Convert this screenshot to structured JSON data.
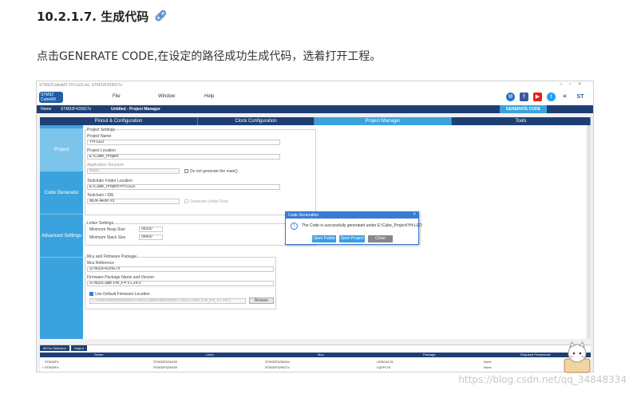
{
  "heading": {
    "title": "10.2.1.7. 生成代码"
  },
  "intro": {
    "text": "点击GENERATE CODE,在设定的路径成功生成代码，选着打开工程。"
  },
  "app": {
    "window_title": "STM32CubeMX YH-LED.ioc: STM32F429IGTx",
    "logo": "STM32 CubeMX",
    "menu": [
      "File",
      "Window",
      "Help"
    ],
    "breadcrumbs": [
      "Home",
      "STM32F429IGTx",
      "Untitled - Project Manager"
    ],
    "generate_label": "GENERATE CODE",
    "tabs": [
      "Pinout & Configuration",
      "Clock Configuration",
      "Project Manager",
      "Tools"
    ],
    "side": [
      "Project",
      "Code Generator",
      "Advanced Settings"
    ],
    "project": {
      "settings_title": "Project Settings",
      "name_label": "Project Name",
      "name_value": "YH-LED",
      "location_label": "Project Location",
      "location_value": "E:\\Cube_Project",
      "structure_label": "Application Structure",
      "structure_value": "Basic",
      "no_main_label": "Do not generate the main()",
      "toolchain_folder_label": "Toolchain Folder Location",
      "toolchain_folder_value": "E:\\Cube_Project\\YH-LED\\",
      "ide_label": "Toolchain / IDE",
      "ide_value": "MDK-ARM V5",
      "gen_under_root": "Generate Under Root",
      "linker_title": "Linker Settings",
      "heap_label": "Minimum Heap Size",
      "heap_value": "0x200",
      "stack_label": "Minimum Stack Size",
      "stack_value": "0x400",
      "mcu_title": "Mcu and Firmware Package",
      "mcu_ref_label": "Mcu Reference",
      "mcu_ref_value": "STM32F429IGTx",
      "fw_label": "Firmware Package Name and Version",
      "fw_value": "STM32Cube FW_F4 V1.24.0",
      "use_default_label": "Use Default Firmware Location",
      "fw_path": "C:/Users/Administrator/STM32Cube/Repository/STM32Cube_FW_F4_V1.24.0",
      "browse_label": "Browse"
    },
    "dialog": {
      "title": "Code Generation",
      "message": "The Code is successfully generated under E:\\Cube_Project\\YH-LED",
      "buttons": [
        "Open Folder",
        "Open Project",
        "Close"
      ]
    },
    "bottom": {
      "tabs": [
        "MCUs Selection",
        "Output"
      ],
      "columns": [
        "Series",
        "Lines",
        "Mcu",
        "Package",
        "Required Peripherals"
      ],
      "rows": [
        [
          "STM32F4",
          "STM32F429/439",
          "STM32F429IGHx",
          "UFBGA176",
          "None"
        ],
        [
          "STM32F4",
          "STM32F429/439",
          "STM32F429IGTx",
          "LQFP176",
          "None"
        ]
      ]
    },
    "colors": {
      "navy": "#1e3f73",
      "accent": "#3aa3dd"
    }
  },
  "watermark": "https://blog.csdn.net/qq_34848334"
}
